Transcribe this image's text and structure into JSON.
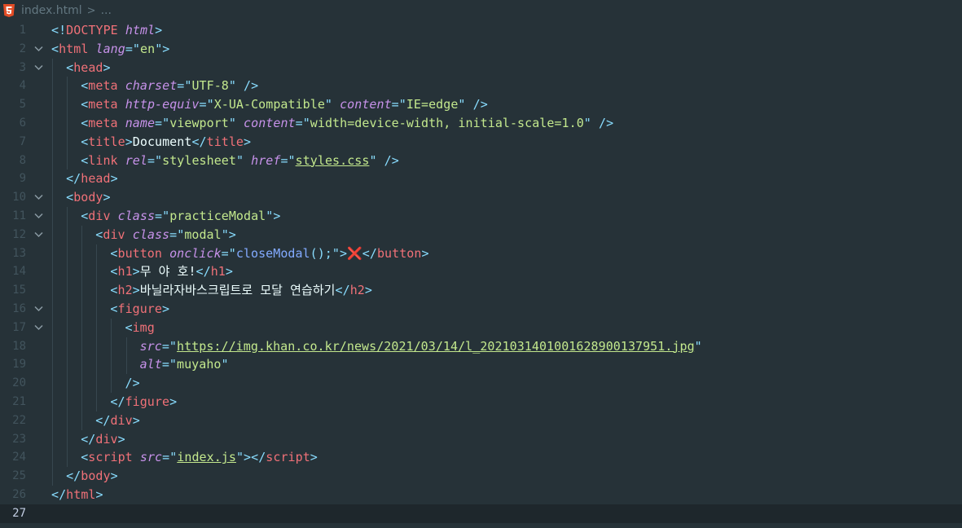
{
  "tab": {
    "filename": "index.html",
    "separator": ">",
    "ellipsis": "..."
  },
  "editor": {
    "current_line": 27,
    "lines": [
      {
        "num": "1",
        "indent": 0,
        "fold": false,
        "tokens": [
          [
            "p",
            "<!"
          ],
          [
            "tag",
            "DOCTYPE"
          ],
          [
            "txt",
            " "
          ],
          [
            "attr",
            "html"
          ],
          [
            "p",
            ">"
          ]
        ]
      },
      {
        "num": "2",
        "indent": 0,
        "fold": true,
        "tokens": [
          [
            "p",
            "<"
          ],
          [
            "tag",
            "html"
          ],
          [
            "txt",
            " "
          ],
          [
            "attr",
            "lang"
          ],
          [
            "p",
            "=\""
          ],
          [
            "str",
            "en"
          ],
          [
            "p",
            "\">"
          ]
        ]
      },
      {
        "num": "3",
        "indent": 1,
        "fold": true,
        "tokens": [
          [
            "p",
            "<"
          ],
          [
            "tag",
            "head"
          ],
          [
            "p",
            ">"
          ]
        ]
      },
      {
        "num": "4",
        "indent": 2,
        "fold": false,
        "tokens": [
          [
            "p",
            "<"
          ],
          [
            "tag",
            "meta"
          ],
          [
            "txt",
            " "
          ],
          [
            "attr",
            "charset"
          ],
          [
            "p",
            "=\""
          ],
          [
            "str",
            "UTF-8"
          ],
          [
            "p",
            "\""
          ],
          [
            "txt",
            " "
          ],
          [
            "p",
            "/>"
          ]
        ]
      },
      {
        "num": "5",
        "indent": 2,
        "fold": false,
        "tokens": [
          [
            "p",
            "<"
          ],
          [
            "tag",
            "meta"
          ],
          [
            "txt",
            " "
          ],
          [
            "attr",
            "http-equiv"
          ],
          [
            "p",
            "=\""
          ],
          [
            "str",
            "X-UA-Compatible"
          ],
          [
            "p",
            "\""
          ],
          [
            "txt",
            " "
          ],
          [
            "attr",
            "content"
          ],
          [
            "p",
            "=\""
          ],
          [
            "str",
            "IE=edge"
          ],
          [
            "p",
            "\""
          ],
          [
            "txt",
            " "
          ],
          [
            "p",
            "/>"
          ]
        ]
      },
      {
        "num": "6",
        "indent": 2,
        "fold": false,
        "tokens": [
          [
            "p",
            "<"
          ],
          [
            "tag",
            "meta"
          ],
          [
            "txt",
            " "
          ],
          [
            "attr",
            "name"
          ],
          [
            "p",
            "=\""
          ],
          [
            "str",
            "viewport"
          ],
          [
            "p",
            "\""
          ],
          [
            "txt",
            " "
          ],
          [
            "attr",
            "content"
          ],
          [
            "p",
            "=\""
          ],
          [
            "str",
            "width=device-width, initial-scale=1.0"
          ],
          [
            "p",
            "\""
          ],
          [
            "txt",
            " "
          ],
          [
            "p",
            "/>"
          ]
        ]
      },
      {
        "num": "7",
        "indent": 2,
        "fold": false,
        "tokens": [
          [
            "p",
            "<"
          ],
          [
            "tag",
            "title"
          ],
          [
            "p",
            ">"
          ],
          [
            "txt",
            "Document"
          ],
          [
            "p",
            "</"
          ],
          [
            "tag",
            "title"
          ],
          [
            "p",
            ">"
          ]
        ]
      },
      {
        "num": "8",
        "indent": 2,
        "fold": false,
        "tokens": [
          [
            "p",
            "<"
          ],
          [
            "tag",
            "link"
          ],
          [
            "txt",
            " "
          ],
          [
            "attr",
            "rel"
          ],
          [
            "p",
            "=\""
          ],
          [
            "str",
            "stylesheet"
          ],
          [
            "p",
            "\""
          ],
          [
            "txt",
            " "
          ],
          [
            "attr",
            "href"
          ],
          [
            "p",
            "=\""
          ],
          [
            "link",
            "styles.css"
          ],
          [
            "p",
            "\""
          ],
          [
            "txt",
            " "
          ],
          [
            "p",
            "/>"
          ]
        ]
      },
      {
        "num": "9",
        "indent": 1,
        "fold": false,
        "tokens": [
          [
            "p",
            "</"
          ],
          [
            "tag",
            "head"
          ],
          [
            "p",
            ">"
          ]
        ]
      },
      {
        "num": "10",
        "indent": 1,
        "fold": true,
        "tokens": [
          [
            "p",
            "<"
          ],
          [
            "tag",
            "body"
          ],
          [
            "p",
            ">"
          ]
        ]
      },
      {
        "num": "11",
        "indent": 2,
        "fold": true,
        "tokens": [
          [
            "p",
            "<"
          ],
          [
            "tag",
            "div"
          ],
          [
            "txt",
            " "
          ],
          [
            "attr",
            "class"
          ],
          [
            "p",
            "=\""
          ],
          [
            "str",
            "practiceModal"
          ],
          [
            "p",
            "\">"
          ]
        ]
      },
      {
        "num": "12",
        "indent": 3,
        "fold": true,
        "tokens": [
          [
            "p",
            "<"
          ],
          [
            "tag",
            "div"
          ],
          [
            "txt",
            " "
          ],
          [
            "attr",
            "class"
          ],
          [
            "p",
            "=\""
          ],
          [
            "str",
            "modal"
          ],
          [
            "p",
            "\">"
          ]
        ]
      },
      {
        "num": "13",
        "indent": 4,
        "fold": false,
        "tokens": [
          [
            "p",
            "<"
          ],
          [
            "tag",
            "button"
          ],
          [
            "txt",
            " "
          ],
          [
            "attr",
            "onclick"
          ],
          [
            "p",
            "=\""
          ],
          [
            "fn",
            "closeModal"
          ],
          [
            "p",
            "();\">"
          ],
          [
            "x",
            "❌"
          ],
          [
            "p",
            "</"
          ],
          [
            "tag",
            "button"
          ],
          [
            "p",
            ">"
          ]
        ]
      },
      {
        "num": "14",
        "indent": 4,
        "fold": false,
        "tokens": [
          [
            "p",
            "<"
          ],
          [
            "tag",
            "h1"
          ],
          [
            "p",
            ">"
          ],
          [
            "txt",
            "무 야 호!"
          ],
          [
            "p",
            "</"
          ],
          [
            "tag",
            "h1"
          ],
          [
            "p",
            ">"
          ]
        ]
      },
      {
        "num": "15",
        "indent": 4,
        "fold": false,
        "tokens": [
          [
            "p",
            "<"
          ],
          [
            "tag",
            "h2"
          ],
          [
            "p",
            ">"
          ],
          [
            "txt",
            "바닐라자바스크립트로 모달 연습하기"
          ],
          [
            "p",
            "</"
          ],
          [
            "tag",
            "h2"
          ],
          [
            "p",
            ">"
          ]
        ]
      },
      {
        "num": "16",
        "indent": 4,
        "fold": true,
        "tokens": [
          [
            "p",
            "<"
          ],
          [
            "tag",
            "figure"
          ],
          [
            "p",
            ">"
          ]
        ]
      },
      {
        "num": "17",
        "indent": 5,
        "fold": true,
        "tokens": [
          [
            "p",
            "<"
          ],
          [
            "tag",
            "img"
          ]
        ]
      },
      {
        "num": "18",
        "indent": 6,
        "fold": false,
        "tokens": [
          [
            "attr",
            "src"
          ],
          [
            "p",
            "=\""
          ],
          [
            "link",
            "https://img.khan.co.kr/news/2021/03/14/l_2021031401001628900137951.jpg"
          ],
          [
            "p",
            "\""
          ]
        ]
      },
      {
        "num": "19",
        "indent": 6,
        "fold": false,
        "tokens": [
          [
            "attr",
            "alt"
          ],
          [
            "p",
            "=\""
          ],
          [
            "str",
            "muyaho"
          ],
          [
            "p",
            "\""
          ]
        ]
      },
      {
        "num": "20",
        "indent": 5,
        "fold": false,
        "tokens": [
          [
            "p",
            "/>"
          ]
        ]
      },
      {
        "num": "21",
        "indent": 4,
        "fold": false,
        "tokens": [
          [
            "p",
            "</"
          ],
          [
            "tag",
            "figure"
          ],
          [
            "p",
            ">"
          ]
        ]
      },
      {
        "num": "22",
        "indent": 3,
        "fold": false,
        "tokens": [
          [
            "p",
            "</"
          ],
          [
            "tag",
            "div"
          ],
          [
            "p",
            ">"
          ]
        ]
      },
      {
        "num": "23",
        "indent": 2,
        "fold": false,
        "tokens": [
          [
            "p",
            "</"
          ],
          [
            "tag",
            "div"
          ],
          [
            "p",
            ">"
          ]
        ]
      },
      {
        "num": "24",
        "indent": 2,
        "fold": false,
        "tokens": [
          [
            "p",
            "<"
          ],
          [
            "tag",
            "script"
          ],
          [
            "txt",
            " "
          ],
          [
            "attr",
            "src"
          ],
          [
            "p",
            "=\""
          ],
          [
            "link",
            "index.js"
          ],
          [
            "p",
            "\">"
          ],
          [
            "p",
            "</"
          ],
          [
            "tag",
            "script"
          ],
          [
            "p",
            ">"
          ]
        ]
      },
      {
        "num": "25",
        "indent": 1,
        "fold": false,
        "tokens": [
          [
            "p",
            "</"
          ],
          [
            "tag",
            "body"
          ],
          [
            "p",
            ">"
          ]
        ]
      },
      {
        "num": "26",
        "indent": 0,
        "fold": false,
        "tokens": [
          [
            "p",
            "</"
          ],
          [
            "tag",
            "html"
          ],
          [
            "p",
            ">"
          ]
        ]
      },
      {
        "num": "27",
        "indent": 0,
        "fold": false,
        "tokens": []
      }
    ]
  },
  "icons": {
    "file": "html5-icon",
    "fold": "chevron-down-icon"
  },
  "colors": {
    "background": "#263238",
    "current_line": "#1e272c",
    "tag": "#f07178",
    "punctuation": "#89ddff",
    "attribute": "#c792ea",
    "string": "#c3e88d",
    "function": "#82aaff",
    "text": "#eeffff",
    "line_number": "#42545d"
  }
}
